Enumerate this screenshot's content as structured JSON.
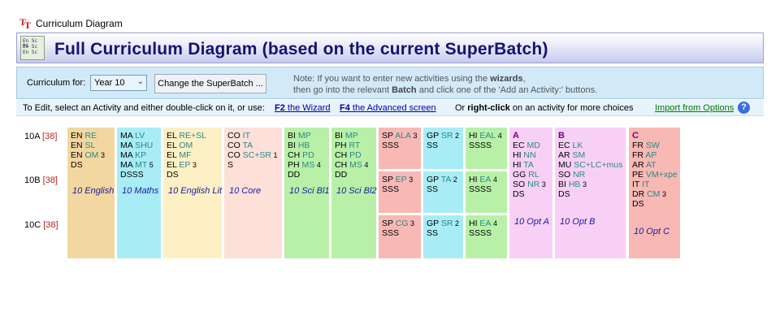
{
  "window": {
    "title": "Curriculum Diagram"
  },
  "banner": {
    "title": "Full Curriculum Diagram (based on the current SuperBatch)"
  },
  "toolbar": {
    "curriculum_label": "Curriculum for:",
    "year_select": "Year 10",
    "change_button": "Change the SuperBatch ...",
    "note_line1": "Note: If you want to enter new activities using the wizards,",
    "note_line2": "then go into the relevant Batch and click one of the 'Add an Activity:' buttons."
  },
  "hint": {
    "text1": "To Edit, select an Activity and either double-click on it, or use:",
    "wizard_link": "F2 the Wizard",
    "advanced_link": "F4 the Advanced screen",
    "text2": "Or right-click on an activity for more choices",
    "import_link": "Import from Options"
  },
  "rows": [
    {
      "label": "10A",
      "count": "[38]"
    },
    {
      "label": "10B",
      "count": "[38]"
    },
    {
      "label": "10C",
      "count": "[38]"
    }
  ],
  "blocks": {
    "english": {
      "caption": "10 English",
      "lines": [
        [
          "EN",
          "RE",
          ""
        ],
        [
          "EN",
          "SL",
          ""
        ],
        [
          "EN",
          "OM",
          "3"
        ]
      ],
      "ds": "DS",
      "color": "#f3d7a0"
    },
    "maths": {
      "caption": "10 Maths",
      "lines": [
        [
          "MA",
          "LV",
          ""
        ],
        [
          "MA",
          "SHU",
          ""
        ],
        [
          "MA",
          "KP",
          ""
        ],
        [
          "MA",
          "MT",
          "5"
        ]
      ],
      "ds": "DSSS",
      "color": "#a8ecf6"
    },
    "englit": {
      "caption": "10 English Lit",
      "lines": [
        [
          "EL",
          "RE+SL",
          ""
        ],
        [
          "EL",
          "OM",
          ""
        ],
        [
          "EL",
          "MF",
          ""
        ],
        [
          "EL",
          "EP",
          "3"
        ]
      ],
      "ds": "DS",
      "color": "#fdf0c4"
    },
    "core": {
      "caption": "10 Core",
      "lines": [
        [
          "CO",
          "IT",
          ""
        ],
        [
          "CO",
          "TA",
          ""
        ],
        [
          "CO",
          "SC+SR",
          "1"
        ]
      ],
      "ds": "S",
      "color": "#fde0d8"
    },
    "scibl1": {
      "caption": "10 Sci Bl1",
      "lines": [
        [
          "BI",
          "MP",
          ""
        ],
        [
          "BI",
          "HB",
          ""
        ],
        [
          "CH",
          "PD",
          ""
        ],
        [
          "PH",
          "MS",
          "4"
        ]
      ],
      "ds": "DD",
      "color": "#b8f0a8"
    },
    "scibl2": {
      "caption": "10 Sci Bl2",
      "lines": [
        [
          "BI",
          "MP",
          ""
        ],
        [
          "PH",
          "RT",
          ""
        ],
        [
          "CH",
          "PD",
          ""
        ],
        [
          "CH",
          "MS",
          "4"
        ]
      ],
      "ds": "DD",
      "color": "#b8f0a8"
    },
    "sp1": {
      "lines": [
        [
          "SP",
          "ALA",
          "3"
        ]
      ],
      "ds": "SSS",
      "color": "#f8b8b4"
    },
    "sp2": {
      "lines": [
        [
          "SP",
          "EP",
          "3"
        ]
      ],
      "ds": "SSS",
      "color": "#f8b8b4"
    },
    "sp3": {
      "lines": [
        [
          "SP",
          "CG",
          "3"
        ]
      ],
      "ds": "SSS",
      "color": "#f8b8b4"
    },
    "gp1": {
      "lines": [
        [
          "GP",
          "SR",
          "2"
        ]
      ],
      "ds": "SS",
      "color": "#a8ecf6"
    },
    "gp2": {
      "lines": [
        [
          "GP",
          "TA",
          "2"
        ]
      ],
      "ds": "SS",
      "color": "#a8ecf6"
    },
    "gp3": {
      "lines": [
        [
          "GP",
          "SR",
          "2"
        ]
      ],
      "ds": "SS",
      "color": "#a8ecf6"
    },
    "hi1": {
      "lines": [
        [
          "HI",
          "EAL",
          "4"
        ]
      ],
      "ds": "SSSS",
      "color": "#b8f0a8"
    },
    "hi2": {
      "lines": [
        [
          "HI",
          "EA",
          "4"
        ]
      ],
      "ds": "SSSS",
      "color": "#b8f0a8"
    },
    "hi3": {
      "lines": [
        [
          "HI",
          "EA",
          "4"
        ]
      ],
      "ds": "SSSS",
      "color": "#b8f0a8"
    },
    "optA": {
      "title": "A",
      "caption": "10 Opt A",
      "lines": [
        [
          "EC",
          "MD",
          ""
        ],
        [
          "HI",
          "NN",
          ""
        ],
        [
          "HI",
          "TA",
          ""
        ],
        [
          "GG",
          "RL",
          ""
        ],
        [
          "SO",
          "NR",
          "3"
        ]
      ],
      "ds": "DS",
      "color": "#f8d0f6"
    },
    "optB": {
      "title": "B",
      "caption": "10 Opt B",
      "lines": [
        [
          "EC",
          "LK",
          ""
        ],
        [
          "AR",
          "SM",
          ""
        ],
        [
          "MU",
          "SC+LC+mus",
          ""
        ],
        [
          "SO",
          "NR",
          ""
        ],
        [
          "BI",
          "HB",
          "3"
        ]
      ],
      "ds": "DS",
      "color": "#f8d0f6"
    },
    "optC": {
      "title": "C",
      "caption": "10 Opt C",
      "lines": [
        [
          "FR",
          "SW",
          ""
        ],
        [
          "FR",
          "AP",
          ""
        ],
        [
          "AR",
          "AT",
          ""
        ],
        [
          "PE",
          "VM+xpe",
          ""
        ],
        [
          "IT",
          "IT",
          ""
        ],
        [
          "DR",
          "CM",
          "3"
        ]
      ],
      "ds": "DS",
      "color": "#f8b8b4"
    }
  }
}
